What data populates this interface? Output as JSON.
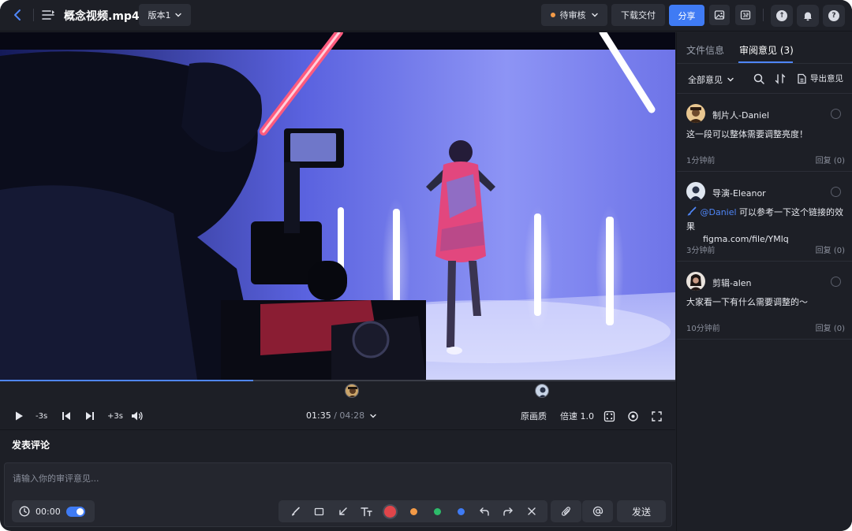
{
  "header": {
    "title": "概念视频.mp4",
    "version_label": "版本1",
    "status_label": "待审核",
    "download_label": "下载交付",
    "share_label": "分享"
  },
  "player": {
    "progress": 0.375,
    "current_time": "01:35",
    "separator": "/",
    "total_time": "04:28",
    "back_label": "-3s",
    "forward_label": "+3s",
    "quality_label": "原画质",
    "speed_label": "倍速 1.0"
  },
  "comment": {
    "title": "发表评论",
    "placeholder": "请输入你的审评意见...",
    "timestamp": "00:00",
    "send_label": "发送",
    "colors": [
      "#e0454a",
      "#f39a47",
      "#2dbb6a",
      "#3f7bf4"
    ]
  },
  "panel": {
    "tab_info": "文件信息",
    "tab_review": "审阅意见 (3)",
    "filter_label": "全部意见",
    "export_label": "导出意见",
    "comments": [
      {
        "author": "制片人-Daniel",
        "text": "这一段可以整体需要调整亮度！",
        "time": "1分钟前",
        "reply": "回复 (0)"
      },
      {
        "author": "导演-Eleanor",
        "mention": "@Daniel",
        "text": " 可以参考一下这个链接的效果",
        "link": "figma.com/file/YMlq",
        "time": "3分钟前",
        "reply": "回复 (0)"
      },
      {
        "author": "剪辑-alen",
        "text": "大家看一下有什么需要调整的～",
        "time": "10分钟前",
        "reply": "回复 (0)"
      }
    ]
  },
  "accent": "#3f7bf4"
}
